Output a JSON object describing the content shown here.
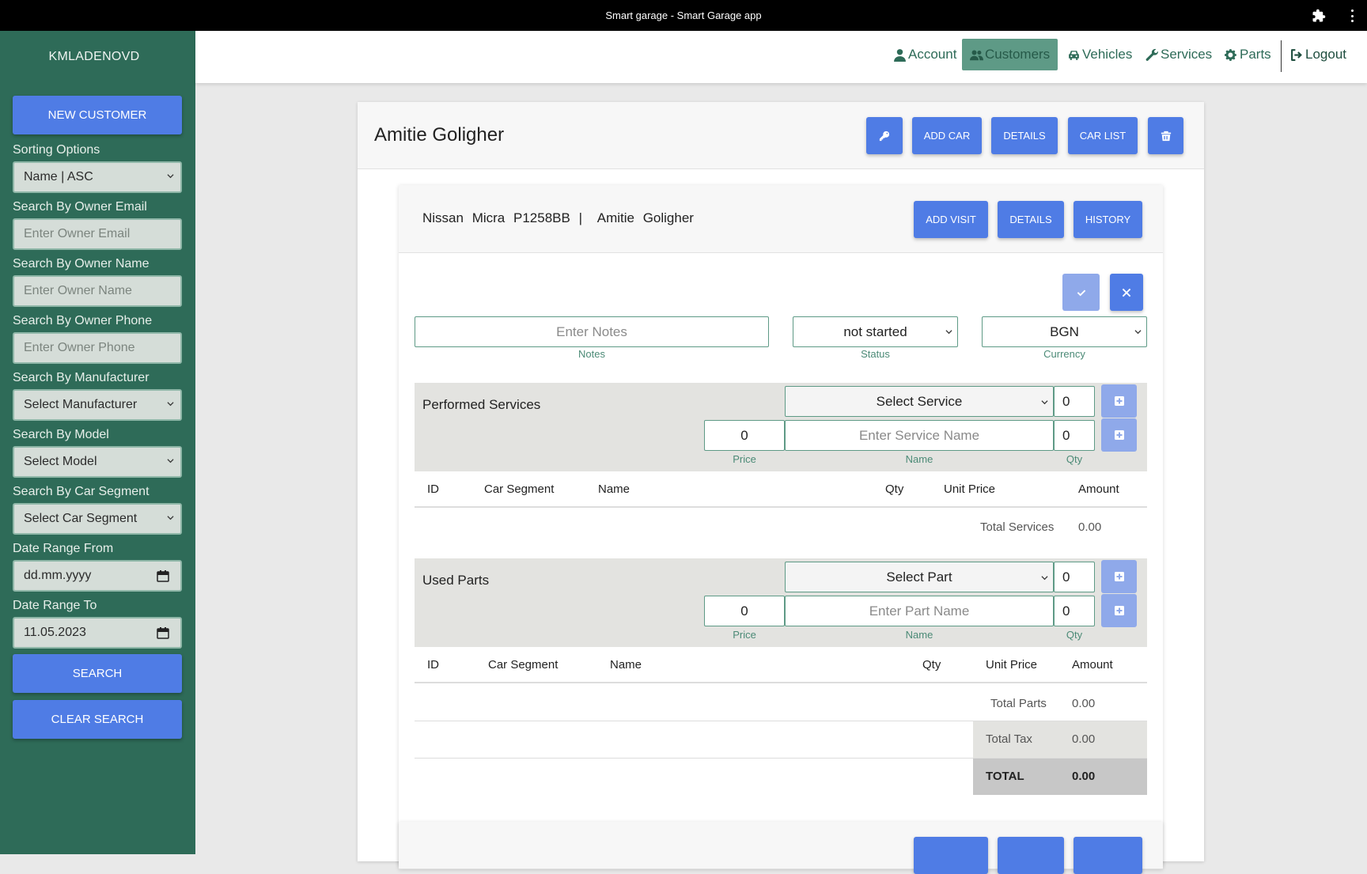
{
  "window": {
    "title": "Smart garage - Smart Garage app"
  },
  "sidebar": {
    "username": "KMLADENOVD",
    "new_customer_label": "NEW CUSTOMER",
    "sorting": {
      "label": "Sorting Options",
      "value": "Name | ASC"
    },
    "owner_email": {
      "label": "Search By Owner Email",
      "placeholder": "Enter Owner Email"
    },
    "owner_name": {
      "label": "Search By Owner Name",
      "placeholder": "Enter Owner Name"
    },
    "owner_phone": {
      "label": "Search By Owner Phone",
      "placeholder": "Enter Owner Phone"
    },
    "manufacturer": {
      "label": "Search By Manufacturer",
      "value": "Select Manufacturer"
    },
    "model": {
      "label": "Search By Model",
      "value": "Select Model"
    },
    "car_segment": {
      "label": "Search By Car Segment",
      "value": "Select Car Segment"
    },
    "date_from": {
      "label": "Date Range From",
      "value": "dd.mm.yyyy"
    },
    "date_to": {
      "label": "Date Range To",
      "value": "11.05.2023"
    },
    "search_label": "SEARCH",
    "clear_label": "CLEAR SEARCH"
  },
  "nav": {
    "items": [
      {
        "label": "Account",
        "icon": "user-icon"
      },
      {
        "label": "Customers",
        "icon": "users-icon",
        "active": true
      },
      {
        "label": "Vehicles",
        "icon": "car-icon"
      },
      {
        "label": "Services",
        "icon": "wrench-icon"
      },
      {
        "label": "Parts",
        "icon": "gears-icon"
      },
      {
        "label": "Logout",
        "icon": "logout-icon"
      }
    ]
  },
  "customer": {
    "name": "Amitie Goligher",
    "buttons": {
      "add_car": "ADD CAR",
      "details": "DETAILS",
      "car_list": "CAR LIST"
    }
  },
  "car": {
    "make": "Nissan",
    "model": "Micra",
    "plate": "P1258BB",
    "separator": "|",
    "owner": "Amitie Goligher",
    "buttons": {
      "add_visit": "ADD VISIT",
      "details": "DETAILS",
      "history": "HISTORY"
    }
  },
  "visit_form": {
    "notes": {
      "placeholder": "Enter Notes",
      "label": "Notes"
    },
    "status": {
      "value": "not started",
      "label": "Status"
    },
    "currency": {
      "value": "BGN",
      "label": "Currency"
    }
  },
  "services": {
    "title": "Performed Services",
    "select_placeholder": "Select Service",
    "select_qty": "0",
    "price": "0",
    "name_placeholder": "Enter Service Name",
    "qty": "0",
    "labels": {
      "price": "Price",
      "name": "Name",
      "qty": "Qty"
    },
    "columns": [
      "ID",
      "Car Segment",
      "Name",
      "Qty",
      "Unit Price",
      "Amount"
    ],
    "total_label": "Total Services",
    "total_value": "0.00"
  },
  "parts": {
    "title": "Used Parts",
    "select_placeholder": "Select Part",
    "select_qty": "0",
    "price": "0",
    "name_placeholder": "Enter Part Name",
    "qty": "0",
    "labels": {
      "price": "Price",
      "name": "Name",
      "qty": "Qty"
    },
    "columns": [
      "ID",
      "Car Segment",
      "Name",
      "Qty",
      "Unit Price",
      "Amount"
    ],
    "total_label": "Total Parts",
    "total_value": "0.00"
  },
  "summary": {
    "tax_label": "Total Tax",
    "tax_value": "0.00",
    "total_label": "TOTAL",
    "total_value": "0.00"
  },
  "colors": {
    "sidebar_bg": "#2e6b58",
    "accent_button": "#4f7ce5",
    "nav_active": "#5e9a86"
  }
}
